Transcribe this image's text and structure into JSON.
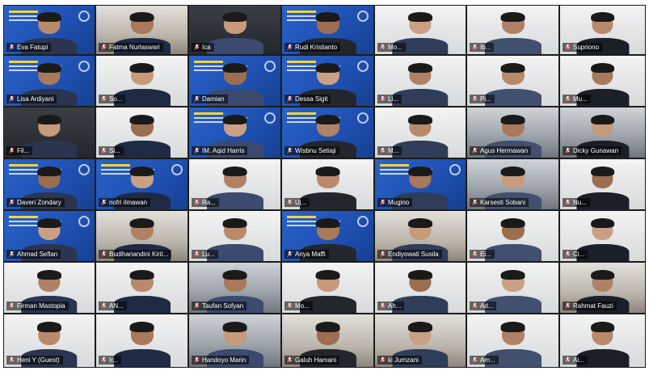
{
  "meeting": {
    "tiles": [
      {
        "name": "Eva Fatupi",
        "style": "blue"
      },
      {
        "name": "Fatma Nurlaswari",
        "style": "room2"
      },
      {
        "name": "Ica",
        "style": "dark"
      },
      {
        "name": "Rudi Kristianto",
        "style": "blue"
      },
      {
        "name": "Mo...",
        "style": "white"
      },
      {
        "name": "Ib...",
        "style": "white"
      },
      {
        "name": "Supriono",
        "style": "white"
      },
      {
        "name": "Lisa Ardiyani",
        "style": "blue"
      },
      {
        "name": "So...",
        "style": "white"
      },
      {
        "name": "Damian",
        "style": "blue"
      },
      {
        "name": "Dessa Sigit",
        "style": "blue"
      },
      {
        "name": "Li...",
        "style": "white"
      },
      {
        "name": "Pi...",
        "style": "white"
      },
      {
        "name": "Mu...",
        "style": "white"
      },
      {
        "name": "Fil...",
        "style": "dark"
      },
      {
        "name": "Si...",
        "style": "white"
      },
      {
        "name": "IM. Aqid Harris",
        "style": "blue"
      },
      {
        "name": "Wisbnu Setiaji",
        "style": "blue"
      },
      {
        "name": "M...",
        "style": "white"
      },
      {
        "name": "Agus Hermawan",
        "style": "room"
      },
      {
        "name": "Dicky Gunawan",
        "style": "room"
      },
      {
        "name": "Daveri Zondary",
        "style": "blue"
      },
      {
        "name": "nofri ilmawan",
        "style": "blue"
      },
      {
        "name": "Ra...",
        "style": "white"
      },
      {
        "name": "Uj...",
        "style": "white"
      },
      {
        "name": "Mugino",
        "style": "blue"
      },
      {
        "name": "Karsesti Sobani",
        "style": "room"
      },
      {
        "name": "Nu...",
        "style": "white"
      },
      {
        "name": "Ahmad Seflan",
        "style": "blue"
      },
      {
        "name": "Budihariandini Kirit...",
        "style": "room2"
      },
      {
        "name": "Lu...",
        "style": "white"
      },
      {
        "name": "Ariya Maffi",
        "style": "blue"
      },
      {
        "name": "Endiyowati Susila",
        "style": "room2"
      },
      {
        "name": "Ei...",
        "style": "white"
      },
      {
        "name": "Ci...",
        "style": "white"
      },
      {
        "name": "Firman Mastopia",
        "style": "white"
      },
      {
        "name": "AN...",
        "style": "white"
      },
      {
        "name": "Taufan Sofyan",
        "style": "room"
      },
      {
        "name": "Mo...",
        "style": "white"
      },
      {
        "name": "Ah...",
        "style": "white"
      },
      {
        "name": "Ad...",
        "style": "white"
      },
      {
        "name": "Rahmat Fauzi",
        "style": "room2"
      },
      {
        "name": "Heni Y (Guest)",
        "style": "white"
      },
      {
        "name": "Ir...",
        "style": "white"
      },
      {
        "name": "Handoyo Marin",
        "style": "room"
      },
      {
        "name": "Galuh Hamani",
        "style": "room2"
      },
      {
        "name": "ki Jumzani",
        "style": "room2"
      },
      {
        "name": "Am...",
        "style": "white"
      },
      {
        "name": "Ai...",
        "style": "white"
      }
    ]
  }
}
